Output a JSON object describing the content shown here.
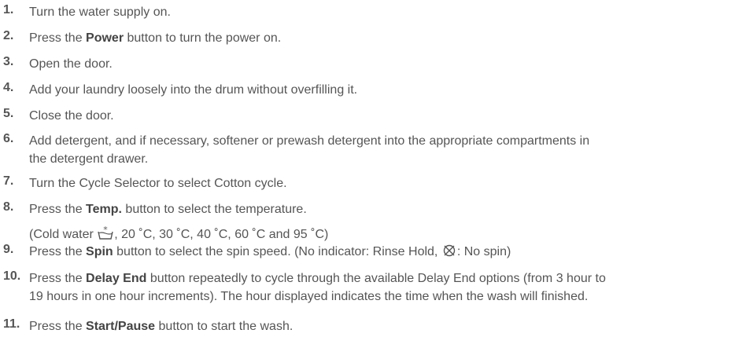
{
  "steps": [
    {
      "num": "1.",
      "text": "Turn the water supply on."
    },
    {
      "num": "2.",
      "pre": "Press the ",
      "bold": "Power",
      "post": " button to turn the power on."
    },
    {
      "num": "3.",
      "text": "Open the door."
    },
    {
      "num": "4.",
      "text": "Add your laundry loosely into the drum without overfilling it."
    },
    {
      "num": "5.",
      "text": "Close the door."
    },
    {
      "num": "6.",
      "line1": "Add detergent, and if necessary, softener or prewash detergent into the appropriate compartments in",
      "line2": "the detergent drawer."
    },
    {
      "num": "7.",
      "text": "Turn the Cycle Selector to select Cotton cycle."
    },
    {
      "num": "8.",
      "pre": "Press the ",
      "bold": "Temp.",
      "post": " button to select the temperature.",
      "sub_pre": "(Cold water ",
      "sub_post": ", 20 ˚C, 30 ˚C, 40 ˚C, 60 ˚C and 95 ˚C)",
      "sub_icon": "cold-water-icon"
    },
    {
      "num": "9.",
      "pre": "Press the ",
      "bold": "Spin",
      "post": " button to select the spin speed. (No indicator: Rinse Hold, ",
      "post_icon": "no-spin-icon",
      "post2": ": No spin)"
    },
    {
      "num": "10.",
      "pre": "Press the ",
      "bold": "Delay End",
      "post": " button repeatedly to cycle through the available Delay End options (from 3 hour to",
      "line2": "19 hours in one hour increments). The hour displayed indicates the time when the wash will finished."
    },
    {
      "num": "11.",
      "pre": "Press the ",
      "bold": "Start/Pause",
      "post": " button to start the wash."
    }
  ]
}
